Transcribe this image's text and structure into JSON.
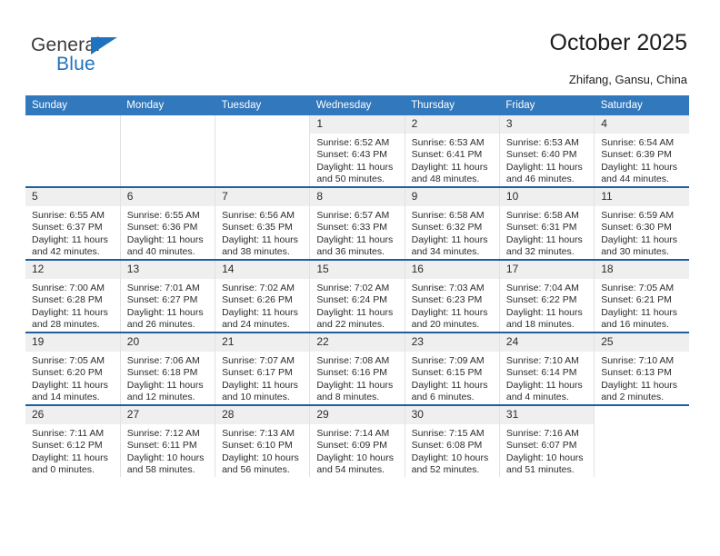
{
  "brand": {
    "name_top": "General",
    "name_bottom": "Blue",
    "triangle_color": "#1f72bd"
  },
  "header": {
    "title": "October 2025",
    "location": "Zhifang, Gansu, China"
  },
  "colors": {
    "header_blue": "#3278bd",
    "row_divider_blue": "#1f5fa0",
    "daynum_band": "#efefef",
    "text": "#2b2b2b"
  },
  "weekday_headers": [
    "Sunday",
    "Monday",
    "Tuesday",
    "Wednesday",
    "Thursday",
    "Friday",
    "Saturday"
  ],
  "weeks": [
    [
      {
        "day": "",
        "sunrise": "",
        "sunset": "",
        "daylight1": "",
        "daylight2": "",
        "empty": true
      },
      {
        "day": "",
        "sunrise": "",
        "sunset": "",
        "daylight1": "",
        "daylight2": "",
        "empty": true
      },
      {
        "day": "",
        "sunrise": "",
        "sunset": "",
        "daylight1": "",
        "daylight2": "",
        "empty": true
      },
      {
        "day": "1",
        "sunrise": "Sunrise: 6:52 AM",
        "sunset": "Sunset: 6:43 PM",
        "daylight1": "Daylight: 11 hours",
        "daylight2": "and 50 minutes.",
        "empty": false
      },
      {
        "day": "2",
        "sunrise": "Sunrise: 6:53 AM",
        "sunset": "Sunset: 6:41 PM",
        "daylight1": "Daylight: 11 hours",
        "daylight2": "and 48 minutes.",
        "empty": false
      },
      {
        "day": "3",
        "sunrise": "Sunrise: 6:53 AM",
        "sunset": "Sunset: 6:40 PM",
        "daylight1": "Daylight: 11 hours",
        "daylight2": "and 46 minutes.",
        "empty": false
      },
      {
        "day": "4",
        "sunrise": "Sunrise: 6:54 AM",
        "sunset": "Sunset: 6:39 PM",
        "daylight1": "Daylight: 11 hours",
        "daylight2": "and 44 minutes.",
        "empty": false
      }
    ],
    [
      {
        "day": "5",
        "sunrise": "Sunrise: 6:55 AM",
        "sunset": "Sunset: 6:37 PM",
        "daylight1": "Daylight: 11 hours",
        "daylight2": "and 42 minutes.",
        "empty": false
      },
      {
        "day": "6",
        "sunrise": "Sunrise: 6:55 AM",
        "sunset": "Sunset: 6:36 PM",
        "daylight1": "Daylight: 11 hours",
        "daylight2": "and 40 minutes.",
        "empty": false
      },
      {
        "day": "7",
        "sunrise": "Sunrise: 6:56 AM",
        "sunset": "Sunset: 6:35 PM",
        "daylight1": "Daylight: 11 hours",
        "daylight2": "and 38 minutes.",
        "empty": false
      },
      {
        "day": "8",
        "sunrise": "Sunrise: 6:57 AM",
        "sunset": "Sunset: 6:33 PM",
        "daylight1": "Daylight: 11 hours",
        "daylight2": "and 36 minutes.",
        "empty": false
      },
      {
        "day": "9",
        "sunrise": "Sunrise: 6:58 AM",
        "sunset": "Sunset: 6:32 PM",
        "daylight1": "Daylight: 11 hours",
        "daylight2": "and 34 minutes.",
        "empty": false
      },
      {
        "day": "10",
        "sunrise": "Sunrise: 6:58 AM",
        "sunset": "Sunset: 6:31 PM",
        "daylight1": "Daylight: 11 hours",
        "daylight2": "and 32 minutes.",
        "empty": false
      },
      {
        "day": "11",
        "sunrise": "Sunrise: 6:59 AM",
        "sunset": "Sunset: 6:30 PM",
        "daylight1": "Daylight: 11 hours",
        "daylight2": "and 30 minutes.",
        "empty": false
      }
    ],
    [
      {
        "day": "12",
        "sunrise": "Sunrise: 7:00 AM",
        "sunset": "Sunset: 6:28 PM",
        "daylight1": "Daylight: 11 hours",
        "daylight2": "and 28 minutes.",
        "empty": false
      },
      {
        "day": "13",
        "sunrise": "Sunrise: 7:01 AM",
        "sunset": "Sunset: 6:27 PM",
        "daylight1": "Daylight: 11 hours",
        "daylight2": "and 26 minutes.",
        "empty": false
      },
      {
        "day": "14",
        "sunrise": "Sunrise: 7:02 AM",
        "sunset": "Sunset: 6:26 PM",
        "daylight1": "Daylight: 11 hours",
        "daylight2": "and 24 minutes.",
        "empty": false
      },
      {
        "day": "15",
        "sunrise": "Sunrise: 7:02 AM",
        "sunset": "Sunset: 6:24 PM",
        "daylight1": "Daylight: 11 hours",
        "daylight2": "and 22 minutes.",
        "empty": false
      },
      {
        "day": "16",
        "sunrise": "Sunrise: 7:03 AM",
        "sunset": "Sunset: 6:23 PM",
        "daylight1": "Daylight: 11 hours",
        "daylight2": "and 20 minutes.",
        "empty": false
      },
      {
        "day": "17",
        "sunrise": "Sunrise: 7:04 AM",
        "sunset": "Sunset: 6:22 PM",
        "daylight1": "Daylight: 11 hours",
        "daylight2": "and 18 minutes.",
        "empty": false
      },
      {
        "day": "18",
        "sunrise": "Sunrise: 7:05 AM",
        "sunset": "Sunset: 6:21 PM",
        "daylight1": "Daylight: 11 hours",
        "daylight2": "and 16 minutes.",
        "empty": false
      }
    ],
    [
      {
        "day": "19",
        "sunrise": "Sunrise: 7:05 AM",
        "sunset": "Sunset: 6:20 PM",
        "daylight1": "Daylight: 11 hours",
        "daylight2": "and 14 minutes.",
        "empty": false
      },
      {
        "day": "20",
        "sunrise": "Sunrise: 7:06 AM",
        "sunset": "Sunset: 6:18 PM",
        "daylight1": "Daylight: 11 hours",
        "daylight2": "and 12 minutes.",
        "empty": false
      },
      {
        "day": "21",
        "sunrise": "Sunrise: 7:07 AM",
        "sunset": "Sunset: 6:17 PM",
        "daylight1": "Daylight: 11 hours",
        "daylight2": "and 10 minutes.",
        "empty": false
      },
      {
        "day": "22",
        "sunrise": "Sunrise: 7:08 AM",
        "sunset": "Sunset: 6:16 PM",
        "daylight1": "Daylight: 11 hours",
        "daylight2": "and 8 minutes.",
        "empty": false
      },
      {
        "day": "23",
        "sunrise": "Sunrise: 7:09 AM",
        "sunset": "Sunset: 6:15 PM",
        "daylight1": "Daylight: 11 hours",
        "daylight2": "and 6 minutes.",
        "empty": false
      },
      {
        "day": "24",
        "sunrise": "Sunrise: 7:10 AM",
        "sunset": "Sunset: 6:14 PM",
        "daylight1": "Daylight: 11 hours",
        "daylight2": "and 4 minutes.",
        "empty": false
      },
      {
        "day": "25",
        "sunrise": "Sunrise: 7:10 AM",
        "sunset": "Sunset: 6:13 PM",
        "daylight1": "Daylight: 11 hours",
        "daylight2": "and 2 minutes.",
        "empty": false
      }
    ],
    [
      {
        "day": "26",
        "sunrise": "Sunrise: 7:11 AM",
        "sunset": "Sunset: 6:12 PM",
        "daylight1": "Daylight: 11 hours",
        "daylight2": "and 0 minutes.",
        "empty": false
      },
      {
        "day": "27",
        "sunrise": "Sunrise: 7:12 AM",
        "sunset": "Sunset: 6:11 PM",
        "daylight1": "Daylight: 10 hours",
        "daylight2": "and 58 minutes.",
        "empty": false
      },
      {
        "day": "28",
        "sunrise": "Sunrise: 7:13 AM",
        "sunset": "Sunset: 6:10 PM",
        "daylight1": "Daylight: 10 hours",
        "daylight2": "and 56 minutes.",
        "empty": false
      },
      {
        "day": "29",
        "sunrise": "Sunrise: 7:14 AM",
        "sunset": "Sunset: 6:09 PM",
        "daylight1": "Daylight: 10 hours",
        "daylight2": "and 54 minutes.",
        "empty": false
      },
      {
        "day": "30",
        "sunrise": "Sunrise: 7:15 AM",
        "sunset": "Sunset: 6:08 PM",
        "daylight1": "Daylight: 10 hours",
        "daylight2": "and 52 minutes.",
        "empty": false
      },
      {
        "day": "31",
        "sunrise": "Sunrise: 7:16 AM",
        "sunset": "Sunset: 6:07 PM",
        "daylight1": "Daylight: 10 hours",
        "daylight2": "and 51 minutes.",
        "empty": false
      },
      {
        "day": "",
        "sunrise": "",
        "sunset": "",
        "daylight1": "",
        "daylight2": "",
        "empty": true
      }
    ]
  ]
}
